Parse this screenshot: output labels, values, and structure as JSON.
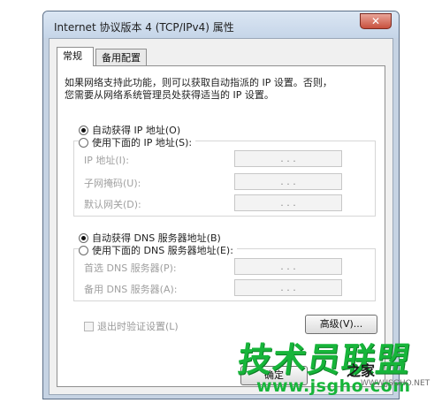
{
  "window": {
    "title": "Internet 协议版本 4 (TCP/IPv4) 属性",
    "close_glyph": "✕"
  },
  "tabs": [
    {
      "label": "常规"
    },
    {
      "label": "备用配置"
    }
  ],
  "description": {
    "line1": "如果网络支持此功能，则可以获取自动指派的 IP 设置。否则，",
    "line2": "您需要从网络系统管理员处获得适当的 IP 设置。"
  },
  "ip": {
    "auto_label": "自动获得 IP 地址(O)",
    "manual_label": "使用下面的 IP 地址(S):",
    "selected": "auto",
    "fields": [
      {
        "label": "IP 地址(I):",
        "value": ". . ."
      },
      {
        "label": "子网掩码(U):",
        "value": ". . ."
      },
      {
        "label": "默认网关(D):",
        "value": ". . ."
      }
    ]
  },
  "dns": {
    "auto_label": "自动获得 DNS 服务器地址(B)",
    "manual_label": "使用下面的 DNS 服务器地址(E):",
    "selected": "auto",
    "fields": [
      {
        "label": "首选 DNS 服务器(P):",
        "value": ". . ."
      },
      {
        "label": "备用 DNS 服务器(A):",
        "value": ". . ."
      }
    ]
  },
  "validate": {
    "label": "退出时验证设置(L)",
    "checked": false
  },
  "buttons": {
    "advanced": "高级(V)...",
    "ok": "确定"
  },
  "watermark": {
    "brand": "技术员联盟",
    "suffix": "之家",
    "url": "www.jsgho.com",
    "faint": "WWW.JSGHO.NET"
  },
  "colors": {
    "watermark_green": "#17b53a",
    "close_red": "#c8503d"
  }
}
